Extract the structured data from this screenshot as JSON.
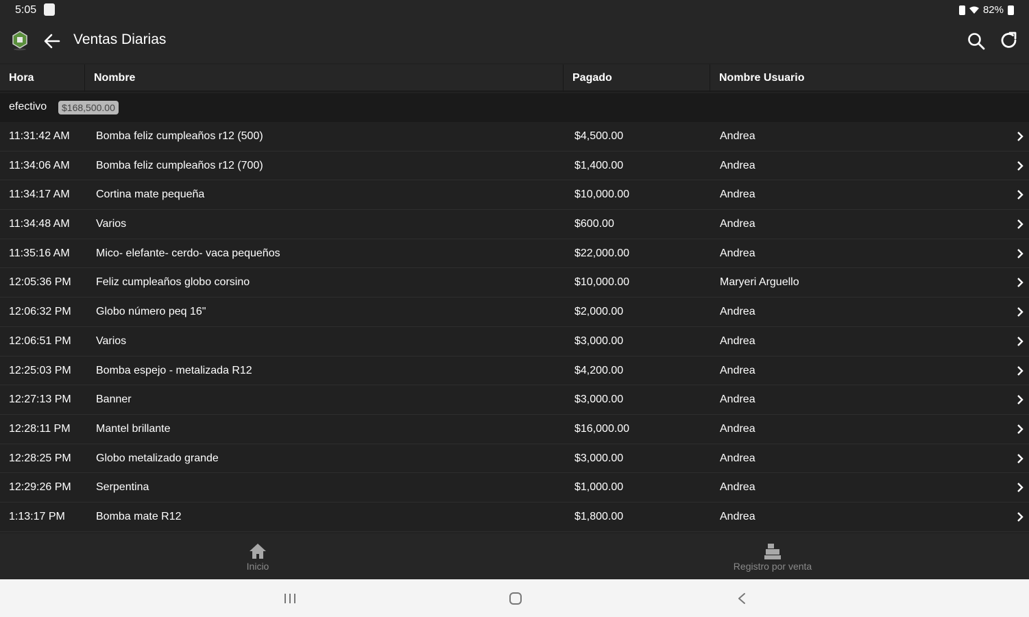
{
  "status_bar": {
    "time": "5:05",
    "battery": "82%"
  },
  "app_bar": {
    "title": "Ventas Diarias"
  },
  "table": {
    "headers": [
      "Hora",
      "Nombre",
      "Pagado",
      "Nombre Usuario"
    ],
    "group": {
      "label": "efectivo",
      "total": "$168,500.00"
    },
    "rows": [
      {
        "time": "11:31:42 AM",
        "name": "Bomba feliz cumpleaños r12 (500)",
        "paid": "$4,500.00",
        "user": "Andrea"
      },
      {
        "time": "11:34:06 AM",
        "name": "Bomba feliz cumpleaños r12 (700)",
        "paid": "$1,400.00",
        "user": "Andrea"
      },
      {
        "time": "11:34:17 AM",
        "name": "Cortina mate pequeña",
        "paid": "$10,000.00",
        "user": "Andrea"
      },
      {
        "time": "11:34:48 AM",
        "name": "Varios",
        "paid": "$600.00",
        "user": "Andrea"
      },
      {
        "time": "11:35:16 AM",
        "name": "Mico- elefante- cerdo- vaca pequeños",
        "paid": "$22,000.00",
        "user": "Andrea"
      },
      {
        "time": "12:05:36 PM",
        "name": "Feliz cumpleaños globo corsino",
        "paid": "$10,000.00",
        "user": "Maryeri Arguello"
      },
      {
        "time": "12:06:32 PM",
        "name": "Globo número peq 16\"",
        "paid": "$2,000.00",
        "user": "Andrea"
      },
      {
        "time": "12:06:51 PM",
        "name": "Varios",
        "paid": "$3,000.00",
        "user": "Andrea"
      },
      {
        "time": "12:25:03 PM",
        "name": "Bomba espejo - metalizada R12",
        "paid": "$4,200.00",
        "user": "Andrea"
      },
      {
        "time": "12:27:13 PM",
        "name": "Banner",
        "paid": "$3,000.00",
        "user": "Andrea"
      },
      {
        "time": "12:28:11 PM",
        "name": "Mantel brillante",
        "paid": "$16,000.00",
        "user": "Andrea"
      },
      {
        "time": "12:28:25 PM",
        "name": "Globo metalizado grande",
        "paid": "$3,000.00",
        "user": "Andrea"
      },
      {
        "time": "12:29:26 PM",
        "name": "Serpentina",
        "paid": "$1,000.00",
        "user": "Andrea"
      },
      {
        "time": "1:13:17 PM",
        "name": "Bomba mate R12",
        "paid": "$1,800.00",
        "user": "Andrea"
      }
    ]
  },
  "bottom_nav": [
    {
      "label": "Inicio",
      "icon": "home-icon"
    },
    {
      "label": "Registro por venta",
      "icon": "register-icon"
    }
  ],
  "colors": {
    "background": "#222222",
    "bar": "#262626",
    "group_badge": "#b8b8b8",
    "logo_green": "#5a8f3c"
  }
}
